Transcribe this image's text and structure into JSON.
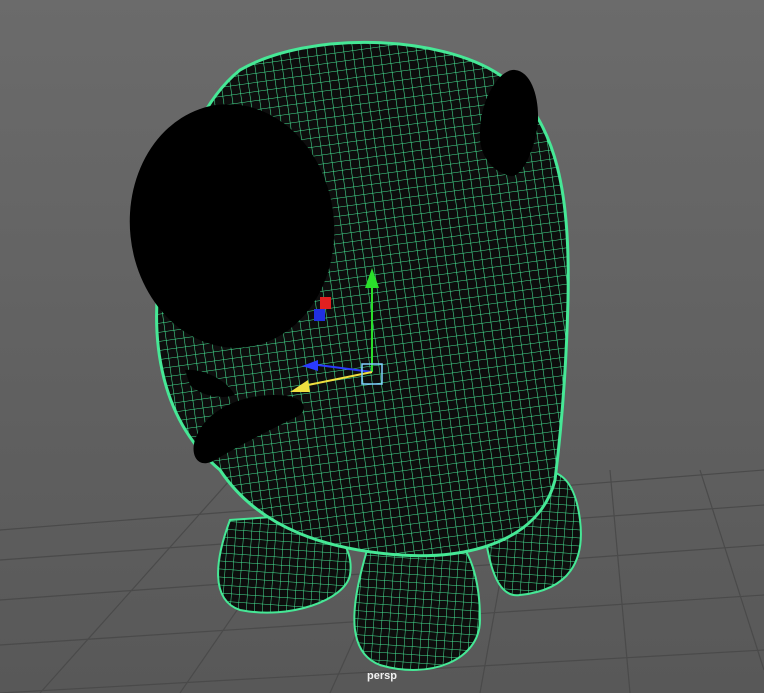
{
  "viewport": {
    "camera_name": "persp",
    "background_color": "#5e5e5e",
    "wireframe_color": "#46e896",
    "grid_color": "#4a4a4a"
  },
  "scene": {
    "object": "character-mesh",
    "display_mode": "wireframe-on-shaded-selected",
    "manipulator": {
      "type": "move-tool",
      "axis_colors": {
        "x": "#ff2a2a",
        "y": "#2adf2a",
        "z": "#2a3aff"
      }
    }
  }
}
